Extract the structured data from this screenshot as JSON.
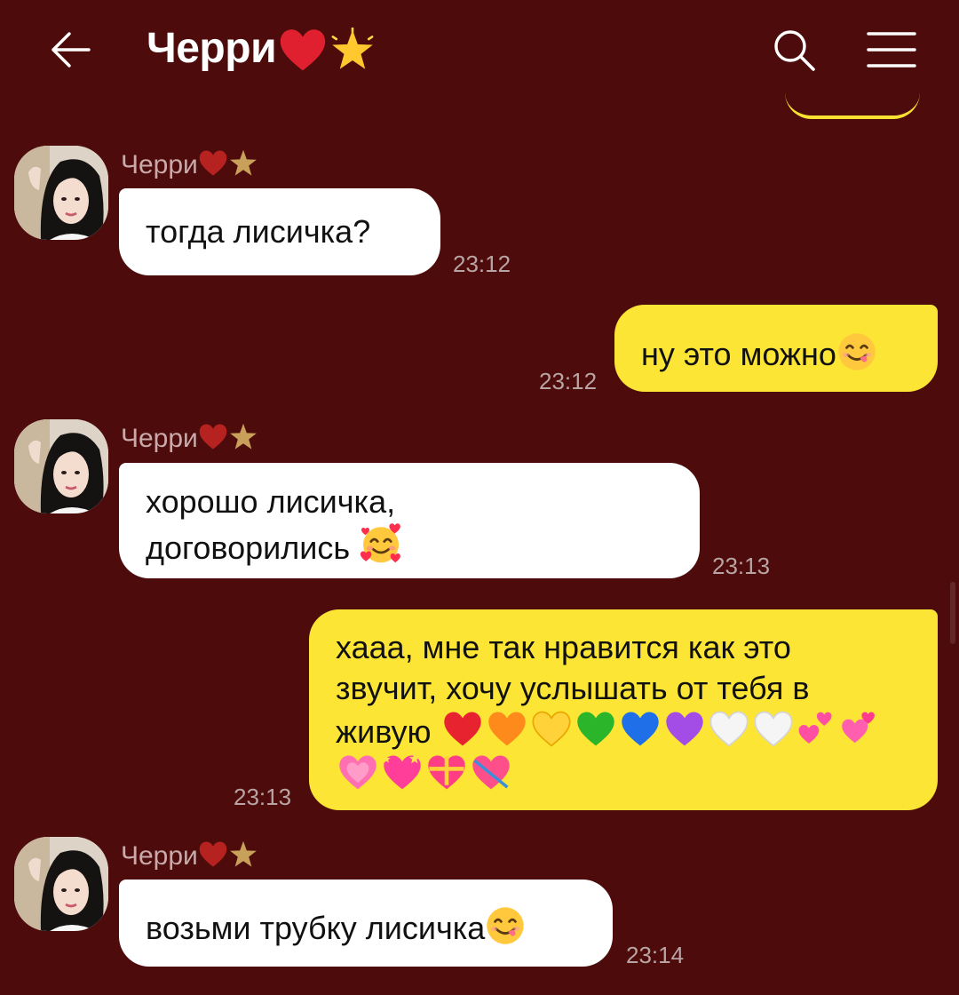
{
  "header": {
    "title": "Черри",
    "back_icon": "back-arrow-icon",
    "search_icon": "search-icon",
    "menu_icon": "hamburger-menu-icon"
  },
  "messages": [
    {
      "direction": "in",
      "sender": "Черри",
      "text": "тогда лисичка?",
      "time": "23:12"
    },
    {
      "direction": "out",
      "text": "ну это можно",
      "emoji": "yum-face",
      "time": "23:12"
    },
    {
      "direction": "in",
      "sender": "Черри",
      "text_line1": "хорошо лисичка,",
      "text_line2": "договорились",
      "emoji": "smiling-face-with-hearts",
      "time": "23:13"
    },
    {
      "direction": "out",
      "text_line1": "хааа, мне так нравится как это",
      "text_line2": "звучит, хочу услышать от тебя в",
      "text_line3": "живую",
      "emoji": "rainbow-hearts",
      "time": "23:13"
    },
    {
      "direction": "in",
      "sender": "Черри",
      "text": "возьми трубку лисичка",
      "emoji": "yum-face",
      "time": "23:14"
    }
  ],
  "colors": {
    "background": "#4d0b0b",
    "incoming_bubble": "#ffffff",
    "outgoing_bubble": "#fce535",
    "sender_name": "#c9a9a9",
    "timestamp": "#b9a4a4"
  }
}
